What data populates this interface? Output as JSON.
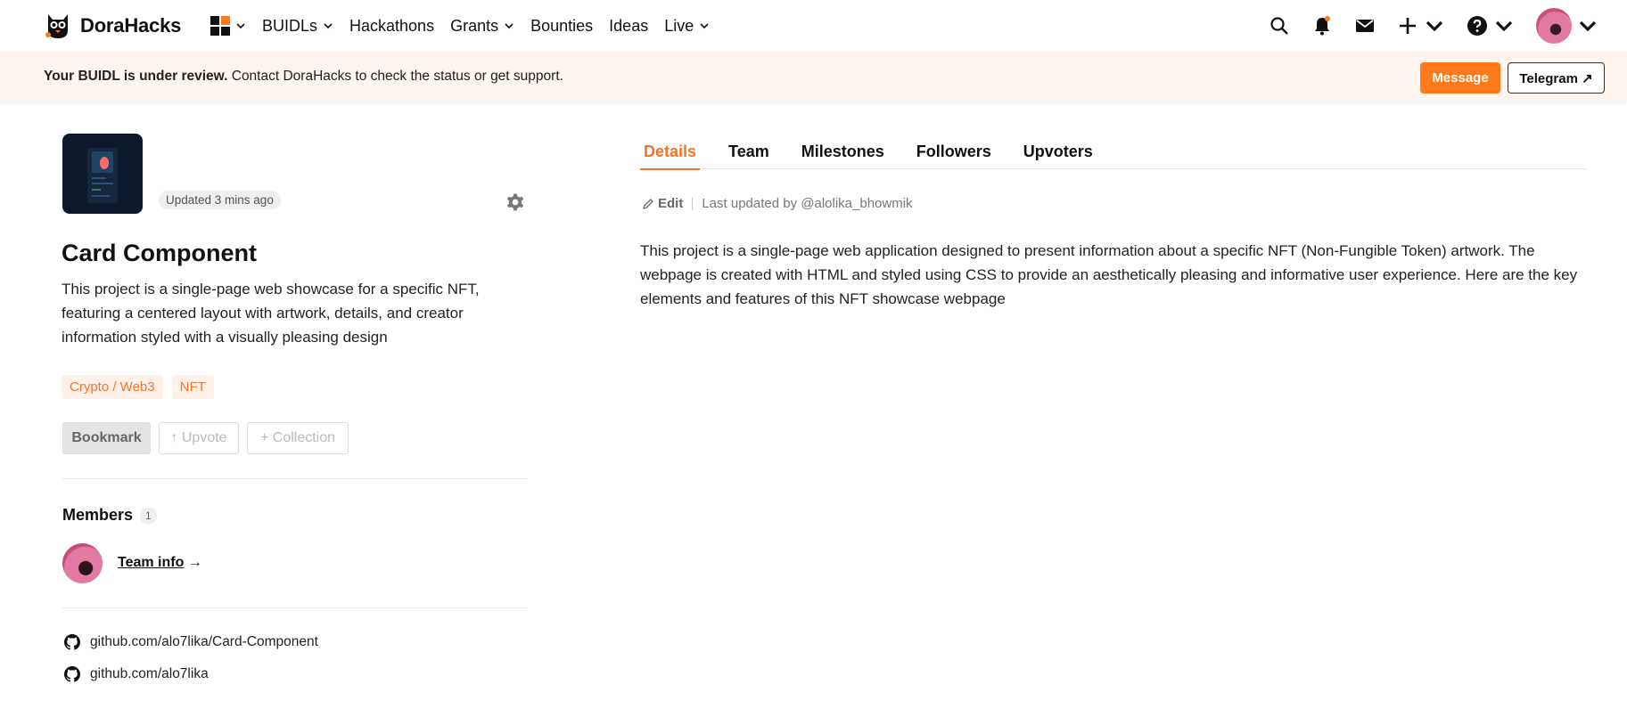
{
  "brand": {
    "name": "DoraHacks"
  },
  "nav": {
    "items": [
      {
        "label": "BUIDLs",
        "has_dropdown": true
      },
      {
        "label": "Hackathons",
        "has_dropdown": false
      },
      {
        "label": "Grants",
        "has_dropdown": true
      },
      {
        "label": "Bounties",
        "has_dropdown": false
      },
      {
        "label": "Ideas",
        "has_dropdown": false
      },
      {
        "label": "Live",
        "has_dropdown": true
      }
    ]
  },
  "banner": {
    "bold_text": "Your BUIDL is under review.",
    "text": " Contact DoraHacks to check the status or get support.",
    "message_button": "Message",
    "telegram_button": "Telegram ↗"
  },
  "project": {
    "updated": "Updated 3 mins ago",
    "title": "Card Component",
    "description": "This project is a single-page web showcase for a specific NFT, featuring a centered layout with artwork, details, and creator information styled with a visually pleasing design",
    "tags": [
      "Crypto / Web3",
      "NFT"
    ],
    "actions": {
      "bookmark": "Bookmark",
      "upvote": "↑ Upvote",
      "collection": "+ Collection"
    }
  },
  "members": {
    "title": "Members",
    "count": "1",
    "team_info": "Team info",
    "arrow": " →"
  },
  "links": [
    "github.com/alo7lika/Card-Component",
    "github.com/alo7lika"
  ],
  "tabs": [
    {
      "label": "Details",
      "active": true
    },
    {
      "label": "Team",
      "active": false
    },
    {
      "label": "Milestones",
      "active": false
    },
    {
      "label": "Followers",
      "active": false
    },
    {
      "label": "Upvoters",
      "active": false
    }
  ],
  "details": {
    "edit_label": "Edit",
    "last_updated": "Last updated by @alolika_bhowmik",
    "body": "This project is a single-page web application designed to present information about a specific NFT (Non-Fungible Token) artwork. The webpage is created with HTML and styled using CSS to provide an aesthetically pleasing and informative user experience. Here are the key elements and features of this NFT showcase webpage"
  },
  "colors": {
    "accent": "#f3742a",
    "banner_bg": "#fff4ee",
    "message_bg": "#ff7a1a"
  }
}
